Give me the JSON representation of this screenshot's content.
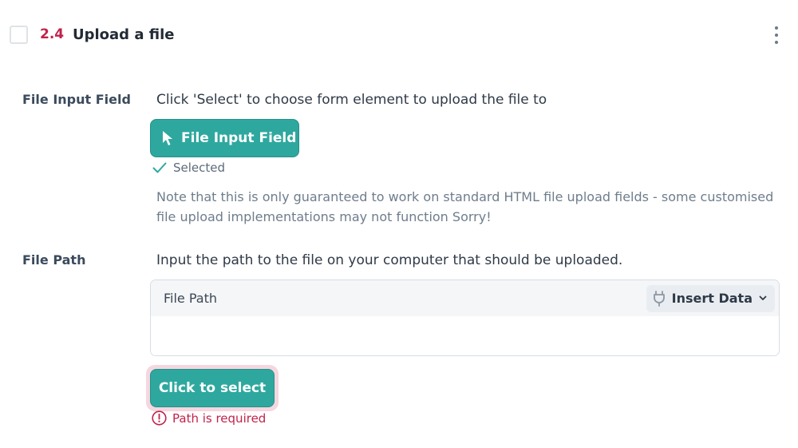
{
  "step": {
    "number": "2.4",
    "title": "Upload a file"
  },
  "file_input_field": {
    "label": "File Input Field",
    "instruction": "Click 'Select' to choose form element to upload the file to",
    "button_label": "File Input Field",
    "status": "Selected",
    "note": "Note that this is only guaranteed to work on standard HTML file upload fields - some customised file upload implementations may not function Sorry!"
  },
  "file_path": {
    "label": "File Path",
    "instruction": "Input the path to the file on your computer that should be uploaded.",
    "input_label": "File Path",
    "insert_data_label": "Insert Data",
    "value": "",
    "select_button_label": "Click to select",
    "error": "Path is required"
  },
  "colors": {
    "accent": "#2ea89f",
    "error": "#c0234b",
    "step_number": "#c0234b"
  },
  "icons": [
    "cursor-arrow-icon",
    "check-icon",
    "plug-icon",
    "chevron-down-icon",
    "error-circle-icon",
    "kebab-menu-icon"
  ]
}
